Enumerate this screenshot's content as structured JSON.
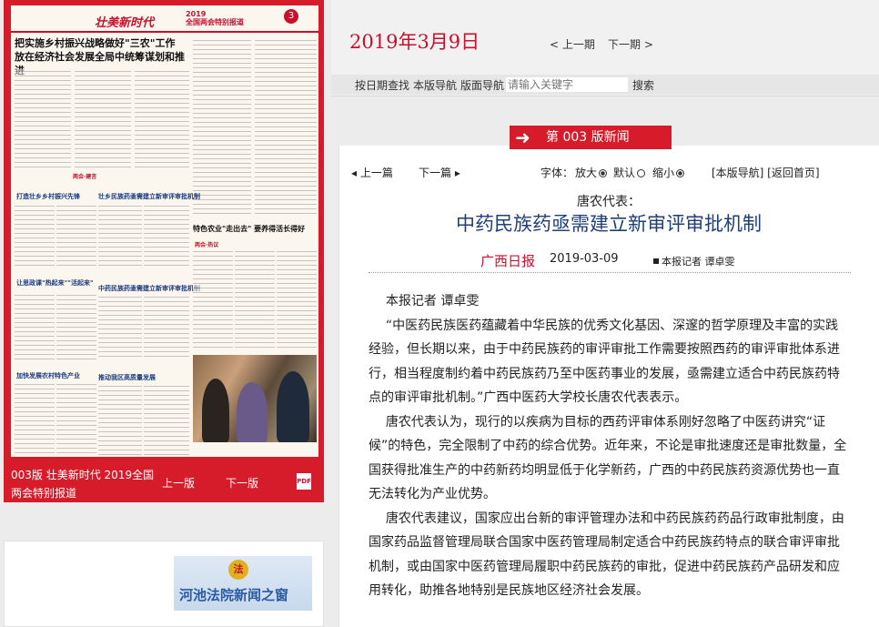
{
  "header": {
    "date": "2019年3月9日",
    "prev_label": "< 上一期",
    "next_label": "下一期 >",
    "toolbar": {
      "date_search": "按日期查找",
      "page_nav": "本版导航",
      "layout_nav": "版面导航",
      "search_placeholder": "请输入关键字",
      "search_button": "搜索"
    }
  },
  "paper": {
    "brand": "壮美新时代",
    "subbrand_year": "2019",
    "subbrand_text": "全国两会特别报道",
    "page_no": "3",
    "headline_line1": "把实施乡村振兴战略做好\"三农\"工作",
    "headline_line2": "放在经济社会发展全局中统筹谋划和推进",
    "section_tag": "两会·建言",
    "section_tag_2": "两会·热议",
    "subhead_1": "打造壮乡乡村振兴先锋",
    "subhead_2": "让思政课\"热起来\"\"活起来\"",
    "subhead_3": "壮乡民族药亟需建立新审评审批机制",
    "subhead_4": "推动我区高质量发展",
    "subhead_5": "中药民族药亟需建立新审评审批机制",
    "subhead_6": "加快发展农村特色产业",
    "feature_title": "特色农业\"走出去\" 要养得活长得好",
    "caption": "003版 壮美新时代 2019全国两会特别报道",
    "prev_page": "上一版",
    "next_page": "下一版",
    "pdf_icon": "PDF"
  },
  "ad": {
    "text": "河池法院新闻之窗",
    "emblem": "法"
  },
  "article": {
    "section_label": "第 003 版新闻",
    "prev_article": "上一篇",
    "next_article": "下一篇",
    "font_label": "字体：",
    "font_big": "放大",
    "font_default": "默认",
    "font_small": "缩小",
    "links": "[本版导航] [返回首页]",
    "kicker": "唐农代表：",
    "title": "中药民族药亟需建立新审评审批机制",
    "source": "广西日报",
    "date": "2019-03-09",
    "reporter": "本报记者 谭卓雯",
    "paragraphs": [
      "本报记者 谭卓雯",
      "“中医药民族医药蕴藏着中华民族的优秀文化基因、深邃的哲学原理及丰富的实践经验，但长期以来，由于中药民族药的审评审批工作需要按照西药的审评审批体系进行，相当程度制约着中药民族药乃至中医药事业的发展，亟需建立适合中药民族药特点的审评审批机制。”广西中医药大学校长唐农代表表示。",
      "唐农代表认为，现行的以疾病为目标的西药评审体系刚好忽略了中医药讲究“证候”的特色，完全限制了中药的综合优势。近年来，不论是审批速度还是审批数量，全国获得批准生产的中药新药均明显低于化学新药，广西的中药民族药资源优势也一直无法转化为产业优势。",
      "唐农代表建议，国家应出台新的审评管理办法和中药民族药药品行政审批制度，由国家药品监督管理局联合国家中医药管理局制定适合中药民族药特点的联合审评审批机制，或由国家中医药管理局履职中药民族药的审批，促进中药民族药产品研发和应用转化，助推各地特别是民族地区经济社会发展。"
    ]
  }
}
